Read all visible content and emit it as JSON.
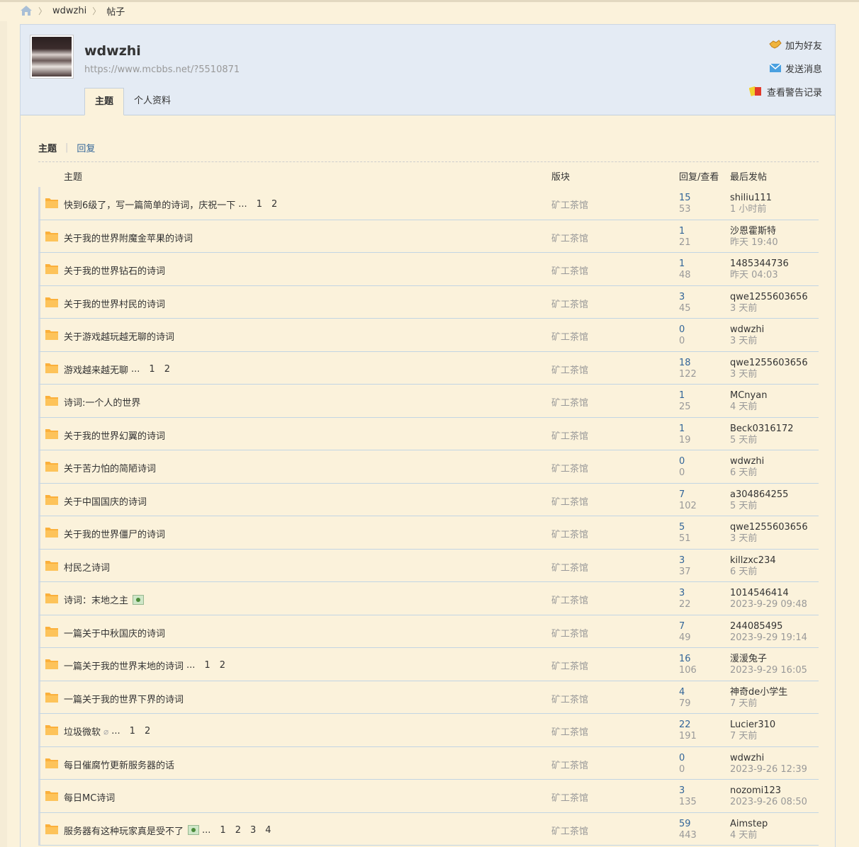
{
  "breadcrumb": {
    "home": "home-icon",
    "user": "wdwzhi",
    "page": "帖子"
  },
  "profile": {
    "name": "wdwzhi",
    "url": "https://www.mcbbs.net/?5510871",
    "tabs": [
      "主题",
      "个人资料"
    ],
    "actions": [
      "加为好友",
      "发送消息",
      "查看警告记录"
    ]
  },
  "subtabs": {
    "active": "主题",
    "other": "回复"
  },
  "table": {
    "headers": {
      "title": "主题",
      "forum": "版块",
      "replies": "回复/查看",
      "last": "最后发帖"
    },
    "rows": [
      {
        "title": "快到6级了，写一篇简单的诗词，庆祝一下",
        "more": "...",
        "pages": [
          "1",
          "2"
        ],
        "forum": "矿工茶馆",
        "replies": "15",
        "views": "53",
        "user": "shiliu111",
        "time": "1 小时前"
      },
      {
        "title": "关于我的世界附魔金苹果的诗词",
        "forum": "矿工茶馆",
        "replies": "1",
        "views": "21",
        "user": "沙恩霍斯特",
        "time": "昨天 19:40"
      },
      {
        "title": "关于我的世界钻石的诗词",
        "forum": "矿工茶馆",
        "replies": "1",
        "views": "48",
        "user": "1485344736",
        "time": "昨天 04:03"
      },
      {
        "title": "关于我的世界村民的诗词",
        "forum": "矿工茶馆",
        "replies": "3",
        "views": "45",
        "user": "qwe1255603656",
        "time": "3 天前"
      },
      {
        "title": "关于游戏越玩越无聊的诗词",
        "forum": "矿工茶馆",
        "replies": "0",
        "views": "0",
        "user": "wdwzhi",
        "time": "3 天前"
      },
      {
        "title": "游戏越来越无聊",
        "more": "...",
        "pages": [
          "1",
          "2"
        ],
        "forum": "矿工茶馆",
        "replies": "18",
        "views": "122",
        "user": "qwe1255603656",
        "time": "3 天前"
      },
      {
        "title": "诗词:一个人的世界",
        "forum": "矿工茶馆",
        "replies": "1",
        "views": "25",
        "user": "MCnyan",
        "time": "4 天前"
      },
      {
        "title": "关于我的世界幻翼的诗词",
        "forum": "矿工茶馆",
        "replies": "1",
        "views": "19",
        "user": "Beck0316172",
        "time": "5 天前"
      },
      {
        "title": "关于苦力怕的简陋诗词",
        "forum": "矿工茶馆",
        "replies": "0",
        "views": "0",
        "user": "wdwzhi",
        "time": "6 天前"
      },
      {
        "title": "关于中国国庆的诗词",
        "forum": "矿工茶馆",
        "replies": "7",
        "views": "102",
        "user": "a304864255",
        "time": "5 天前"
      },
      {
        "title": "关于我的世界僵尸的诗词",
        "forum": "矿工茶馆",
        "replies": "5",
        "views": "51",
        "user": "qwe1255603656",
        "time": "3 天前"
      },
      {
        "title": "村民之诗词",
        "forum": "矿工茶馆",
        "replies": "3",
        "views": "37",
        "user": "killzxc234",
        "time": "6 天前"
      },
      {
        "title": "诗词：末地之主",
        "image": "image-icon",
        "forum": "矿工茶馆",
        "replies": "3",
        "views": "22",
        "user": "1014546414",
        "time": "2023-9-29 09:48"
      },
      {
        "title": "一篇关于中秋国庆的诗词",
        "forum": "矿工茶馆",
        "replies": "7",
        "views": "49",
        "user": "244085495",
        "time": "2023-9-29 19:14"
      },
      {
        "title": "一篇关于我的世界末地的诗词",
        "more": "...",
        "pages": [
          "1",
          "2"
        ],
        "forum": "矿工茶馆",
        "replies": "16",
        "views": "106",
        "user": "湲湲兔子",
        "time": "2023-9-29 16:05"
      },
      {
        "title": "一篇关于我的世界下界的诗词",
        "forum": "矿工茶馆",
        "replies": "4",
        "views": "79",
        "user": "神奇de小学生",
        "time": "7 天前"
      },
      {
        "title": "垃圾微软",
        "attach": "attachment-icon",
        "more": "...",
        "pages": [
          "1",
          "2"
        ],
        "forum": "矿工茶馆",
        "replies": "22",
        "views": "191",
        "user": "Lucier310",
        "time": "7 天前"
      },
      {
        "title": "每日催腐竹更新服务器的话",
        "forum": "矿工茶馆",
        "replies": "0",
        "views": "0",
        "user": "wdwzhi",
        "time": "2023-9-26 12:39"
      },
      {
        "title": "每日MC诗词",
        "forum": "矿工茶馆",
        "replies": "3",
        "views": "135",
        "user": "nozomi123",
        "time": "2023-9-26 08:50"
      },
      {
        "title": "服务器有这种玩家真是受不了",
        "image": "image-icon",
        "more": "...",
        "pages": [
          "1",
          "2",
          "3",
          "4"
        ],
        "forum": "矿工茶馆",
        "replies": "59",
        "views": "443",
        "user": "Aimstep",
        "time": "4 天前"
      }
    ]
  }
}
